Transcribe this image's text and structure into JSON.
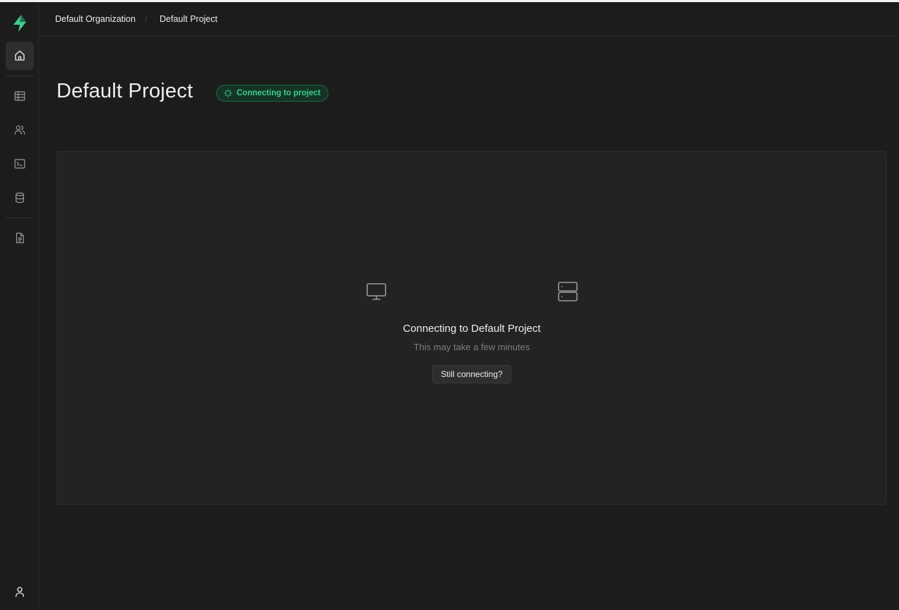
{
  "colors": {
    "background": "#1c1c1c",
    "panel": "#232323",
    "accent": "#3ecf8e",
    "text": "#ededed",
    "muted": "#7c7c7c"
  },
  "sidebar": {
    "logo": "supabase-logo-icon",
    "items": [
      {
        "name": "home",
        "icon": "home-icon",
        "active": true
      },
      {
        "name": "table-editor",
        "icon": "table-icon"
      },
      {
        "name": "authentication",
        "icon": "users-icon"
      },
      {
        "name": "sql-editor",
        "icon": "terminal-icon"
      },
      {
        "name": "database",
        "icon": "database-icon"
      },
      {
        "name": "reports",
        "icon": "file-text-icon"
      }
    ],
    "footer_icon": "user-icon"
  },
  "breadcrumb": {
    "organization": "Default Organization",
    "project": "Default Project",
    "separator": "/"
  },
  "page": {
    "title": "Default Project",
    "status": "Connecting to project"
  },
  "connection": {
    "title": "Connecting to Default Project",
    "subtitle": "This may take a few minutes",
    "button": "Still connecting?"
  }
}
